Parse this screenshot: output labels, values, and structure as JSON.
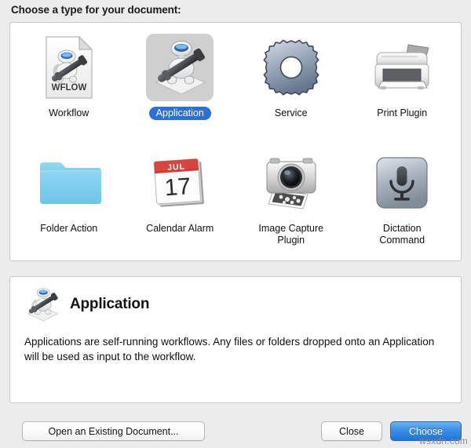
{
  "dialog": {
    "title": "Choose a type for your document:"
  },
  "types": [
    {
      "label": "Workflow",
      "icon": "workflow-document-icon",
      "selected": false
    },
    {
      "label": "Application",
      "icon": "automator-robot-icon",
      "selected": true
    },
    {
      "label": "Service",
      "icon": "gear-icon",
      "selected": false
    },
    {
      "label": "Print Plugin",
      "icon": "printer-icon",
      "selected": false
    },
    {
      "label": "Folder Action",
      "icon": "folder-icon",
      "selected": false
    },
    {
      "label": "Calendar Alarm",
      "icon": "calendar-icon",
      "selected": false
    },
    {
      "label": "Image Capture\nPlugin",
      "icon": "camera-icon",
      "selected": false
    },
    {
      "label": "Dictation\nCommand",
      "icon": "microphone-icon",
      "selected": false
    }
  ],
  "calendar": {
    "month": "JUL",
    "day": "17"
  },
  "workflow_icon": {
    "badge_text": "WFLOW"
  },
  "description": {
    "icon": "automator-robot-icon",
    "title": "Application",
    "body": "Applications are self-running workflows. Any files or folders dropped onto an Application will be used as input to the workflow."
  },
  "buttons": {
    "open_existing": "Open an Existing Document...",
    "close": "Close",
    "choose": "Choose"
  },
  "watermark": "wsxdn.com",
  "colors": {
    "window_background": "#ececec",
    "panel_background": "#ffffff",
    "panel_border": "#c8c8c8",
    "selection_blue": "#2a6fdb",
    "selection_icon_background": "#cfcfcf",
    "default_button_blue": "#3d91e8",
    "folder_blue": "#7fd1f0",
    "calendar_red": "#d7453c",
    "gear_gray": "#8b9bb0"
  }
}
